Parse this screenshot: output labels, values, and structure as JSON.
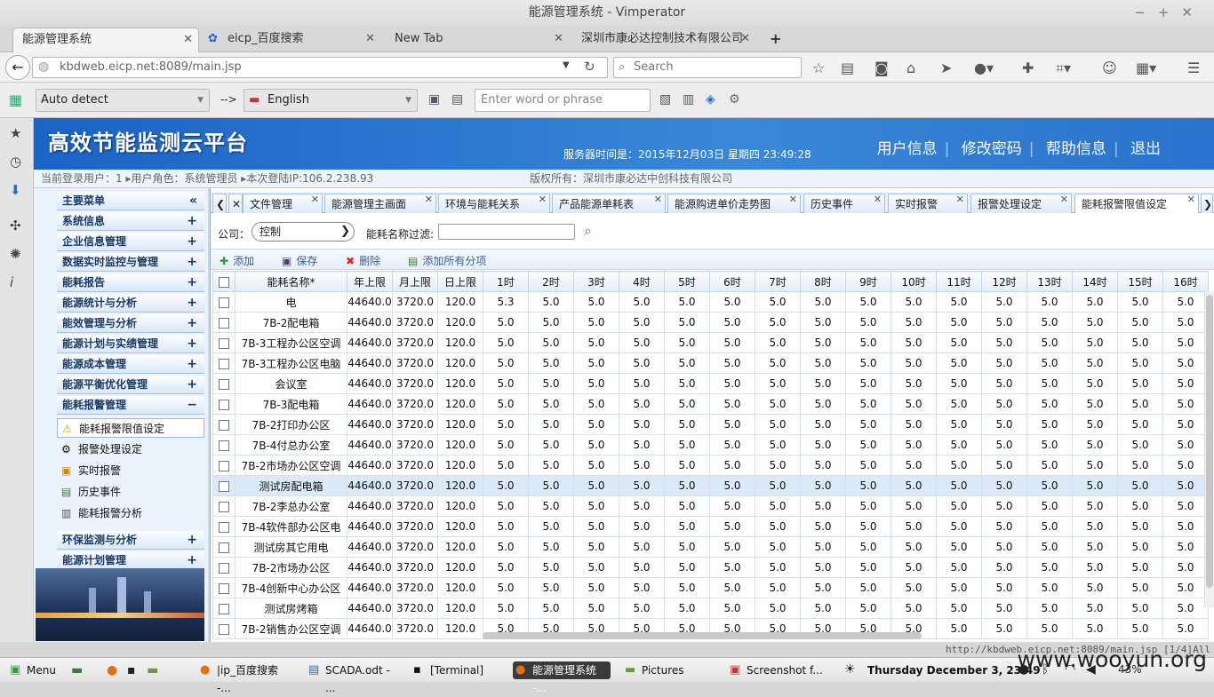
{
  "window": {
    "title": "能源管理系统 - Vimperator"
  },
  "browser_tabs": [
    {
      "label": "能源管理系统"
    },
    {
      "label": "eicp_百度搜索"
    },
    {
      "label": "New Tab"
    },
    {
      "label": "深圳市康必达控制技术有限公司"
    }
  ],
  "address": {
    "url": "kbdweb.eicp.net:8089/main.jsp",
    "search_placeholder": "Search"
  },
  "translator": {
    "source": "Auto detect",
    "arrow": "-->",
    "target": "English",
    "input_placeholder": "Enter word or phrase"
  },
  "app": {
    "banner_title": "高效节能监测云平台",
    "server_time": "服务器时间是：2015年12月03日 星期四 23:49:28",
    "top_links": [
      "用户信息",
      "修改密码",
      "帮助信息",
      "退出"
    ],
    "info_left": "当前登录用户：1  ▸用户角色：系统管理员  ▸本次登陆IP:106.2.238.93",
    "copyright": "版权所有：深圳市康必达中创科技有限公司"
  },
  "sidebar": {
    "header": "主要菜单",
    "menus": [
      "系统信息",
      "企业信息管理",
      "数据实时监控与管理",
      "能耗报告",
      "能源统计与分析",
      "能效管理与分析",
      "能源计划与实绩管理",
      "能源成本管理",
      "能源平衡优化管理",
      "能耗报警管理"
    ],
    "submenus": [
      "能耗报警限值设定",
      "报警处理设定",
      "实时报警",
      "历史事件",
      "能耗报警分析"
    ],
    "menus_after": [
      "环保监测与分析",
      "能源计划管理"
    ]
  },
  "page_tabs": [
    "文件管理",
    "能源管理主画面",
    "环境与能耗关系",
    "产品能源单耗表",
    "能源购进单价走势图",
    "历史事件",
    "实时报警",
    "报警处理设定",
    "能耗报警限值设定"
  ],
  "filter": {
    "company_label": "公司：",
    "company_value": "控制",
    "name_filter_label": "能耗名称过滤:"
  },
  "toolbar": {
    "add": "添加",
    "save": "保存",
    "delete": "删除",
    "add_all": "添加所有分项"
  },
  "grid": {
    "columns": [
      "能耗名称*",
      "年上限",
      "月上限",
      "日上限",
      "1时",
      "2时",
      "3时",
      "4时",
      "5时",
      "6时",
      "7时",
      "8时",
      "9时",
      "10时",
      "11时",
      "12时",
      "13时",
      "14时",
      "15时",
      "16时"
    ],
    "rows": [
      [
        "电",
        "44640.0",
        "3720.0",
        "120.0",
        "5.3",
        "5.0",
        "5.0",
        "5.0",
        "5.0",
        "5.0",
        "5.0",
        "5.0",
        "5.0",
        "5.0",
        "5.0",
        "5.0",
        "5.0",
        "5.0",
        "5.0",
        "5.0"
      ],
      [
        "7B-2配电箱",
        "44640.0",
        "3720.0",
        "120.0",
        "5.0",
        "5.0",
        "5.0",
        "5.0",
        "5.0",
        "5.0",
        "5.0",
        "5.0",
        "5.0",
        "5.0",
        "5.0",
        "5.0",
        "5.0",
        "5.0",
        "5.0",
        "5.0"
      ],
      [
        "7B-3工程办公区空调",
        "44640.0",
        "3720.0",
        "120.0",
        "5.0",
        "5.0",
        "5.0",
        "5.0",
        "5.0",
        "5.0",
        "5.0",
        "5.0",
        "5.0",
        "5.0",
        "5.0",
        "5.0",
        "5.0",
        "5.0",
        "5.0",
        "5.0"
      ],
      [
        "7B-3工程办公区电脑",
        "44640.0",
        "3720.0",
        "120.0",
        "5.0",
        "5.0",
        "5.0",
        "5.0",
        "5.0",
        "5.0",
        "5.0",
        "5.0",
        "5.0",
        "5.0",
        "5.0",
        "5.0",
        "5.0",
        "5.0",
        "5.0",
        "5.0"
      ],
      [
        "会议室",
        "44640.0",
        "3720.0",
        "120.0",
        "5.0",
        "5.0",
        "5.0",
        "5.0",
        "5.0",
        "5.0",
        "5.0",
        "5.0",
        "5.0",
        "5.0",
        "5.0",
        "5.0",
        "5.0",
        "5.0",
        "5.0",
        "5.0"
      ],
      [
        "7B-3配电箱",
        "44640.0",
        "3720.0",
        "120.0",
        "5.0",
        "5.0",
        "5.0",
        "5.0",
        "5.0",
        "5.0",
        "5.0",
        "5.0",
        "5.0",
        "5.0",
        "5.0",
        "5.0",
        "5.0",
        "5.0",
        "5.0",
        "5.0"
      ],
      [
        "7B-2打印办公区",
        "44640.0",
        "3720.0",
        "120.0",
        "5.0",
        "5.0",
        "5.0",
        "5.0",
        "5.0",
        "5.0",
        "5.0",
        "5.0",
        "5.0",
        "5.0",
        "5.0",
        "5.0",
        "5.0",
        "5.0",
        "5.0",
        "5.0"
      ],
      [
        "7B-4付总办公室",
        "44640.0",
        "3720.0",
        "120.0",
        "5.0",
        "5.0",
        "5.0",
        "5.0",
        "5.0",
        "5.0",
        "5.0",
        "5.0",
        "5.0",
        "5.0",
        "5.0",
        "5.0",
        "5.0",
        "5.0",
        "5.0",
        "5.0"
      ],
      [
        "7B-2市场办公区空调",
        "44640.0",
        "3720.0",
        "120.0",
        "5.0",
        "5.0",
        "5.0",
        "5.0",
        "5.0",
        "5.0",
        "5.0",
        "5.0",
        "5.0",
        "5.0",
        "5.0",
        "5.0",
        "5.0",
        "5.0",
        "5.0",
        "5.0"
      ],
      [
        "测试房配电箱",
        "44640.0",
        "3720.0",
        "120.0",
        "5.0",
        "5.0",
        "5.0",
        "5.0",
        "5.0",
        "5.0",
        "5.0",
        "5.0",
        "5.0",
        "5.0",
        "5.0",
        "5.0",
        "5.0",
        "5.0",
        "5.0",
        "5.0"
      ],
      [
        "7B-2李总办公室",
        "44640.0",
        "3720.0",
        "120.0",
        "5.0",
        "5.0",
        "5.0",
        "5.0",
        "5.0",
        "5.0",
        "5.0",
        "5.0",
        "5.0",
        "5.0",
        "5.0",
        "5.0",
        "5.0",
        "5.0",
        "5.0",
        "5.0"
      ],
      [
        "7B-4软件部办公区电",
        "44640.0",
        "3720.0",
        "120.0",
        "5.0",
        "5.0",
        "5.0",
        "5.0",
        "5.0",
        "5.0",
        "5.0",
        "5.0",
        "5.0",
        "5.0",
        "5.0",
        "5.0",
        "5.0",
        "5.0",
        "5.0",
        "5.0"
      ],
      [
        "测试房其它用电",
        "44640.0",
        "3720.0",
        "120.0",
        "5.0",
        "5.0",
        "5.0",
        "5.0",
        "5.0",
        "5.0",
        "5.0",
        "5.0",
        "5.0",
        "5.0",
        "5.0",
        "5.0",
        "5.0",
        "5.0",
        "5.0",
        "5.0"
      ],
      [
        "7B-2市场办公区",
        "44640.0",
        "3720.0",
        "120.0",
        "5.0",
        "5.0",
        "5.0",
        "5.0",
        "5.0",
        "5.0",
        "5.0",
        "5.0",
        "5.0",
        "5.0",
        "5.0",
        "5.0",
        "5.0",
        "5.0",
        "5.0",
        "5.0"
      ],
      [
        "7B-4创新中心办公区",
        "44640.0",
        "3720.0",
        "120.0",
        "5.0",
        "5.0",
        "5.0",
        "5.0",
        "5.0",
        "5.0",
        "5.0",
        "5.0",
        "5.0",
        "5.0",
        "5.0",
        "5.0",
        "5.0",
        "5.0",
        "5.0",
        "5.0"
      ],
      [
        "测试房烤箱",
        "44640.0",
        "3720.0",
        "120.0",
        "5.0",
        "5.0",
        "5.0",
        "5.0",
        "5.0",
        "5.0",
        "5.0",
        "5.0",
        "5.0",
        "5.0",
        "5.0",
        "5.0",
        "5.0",
        "5.0",
        "5.0",
        "5.0"
      ],
      [
        "7B-2销售办公区空调",
        "44640.0",
        "3720.0",
        "120.0",
        "5.0",
        "5.0",
        "5.0",
        "5.0",
        "5.0",
        "5.0",
        "5.0",
        "5.0",
        "5.0",
        "5.0",
        "5.0",
        "5.0",
        "5.0",
        "5.0",
        "5.0",
        "5.0"
      ]
    ]
  },
  "status_url": "http://kbdweb.eicp.net:8089/main.jsp [1/4]All",
  "taskbar": {
    "menu": "Menu",
    "items": [
      "|ip_百度搜索 -...",
      "SCADA.odt - ...",
      "[Terminal]",
      "能源管理系统 -...",
      "Pictures",
      "Screenshot f..."
    ],
    "clock": "Thursday December  3, 23:49",
    "battery": "43%"
  },
  "watermark": "www.wooyun.org"
}
